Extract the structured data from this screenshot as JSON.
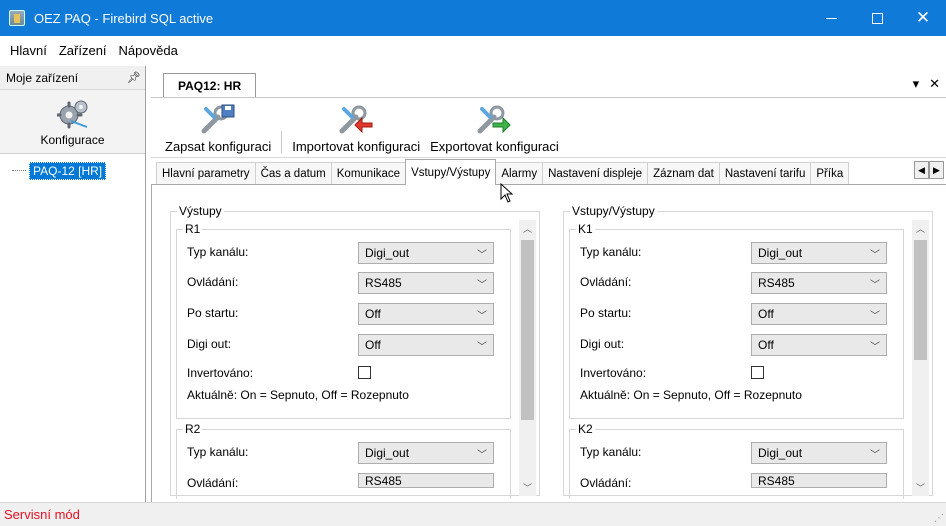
{
  "window": {
    "title": "OEZ PAQ - Firebird SQL active"
  },
  "menu": {
    "items": [
      "Hlavní",
      "Zařízení",
      "Nápověda"
    ]
  },
  "left_panel": {
    "title": "Moje zařízení",
    "tool_label": "Konfigurace",
    "tree_item": "PAQ-12 [HR]"
  },
  "document": {
    "tab_label": "PAQ12: HR",
    "toolbar": {
      "save": "Zapsat konfiguraci",
      "import": "Importovat konfiguraci",
      "export": "Exportovat konfiguraci"
    },
    "subtabs": [
      "Hlavní parametry",
      "Čas a datum",
      "Komunikace",
      "Vstupy/Výstupy",
      "Alarmy",
      "Nastavení displeje",
      "Záznam dat",
      "Nastavení tarifu",
      "Příka"
    ],
    "active_subtab": "Vstupy/Výstupy"
  },
  "labels": {
    "typ_kanalu": "Typ kanálu:",
    "ovladani": "Ovládání:",
    "po_startu": "Po startu:",
    "digi_out": "Digi out:",
    "invertovano": "Invertováno:",
    "aktualne": "Aktuálně: On = Sepnuto, Off = Rozepnuto"
  },
  "left_group": {
    "title": "Výstupy",
    "first": {
      "title": "R1",
      "typ": "Digi_out",
      "ovladani": "RS485",
      "po_startu": "Off",
      "digi_out": "Off",
      "invertovano": false
    },
    "second": {
      "title": "R2",
      "typ": "Digi_out",
      "ovladani": "RS485"
    }
  },
  "right_group": {
    "title": "Vstupy/Výstupy",
    "first": {
      "title": "K1",
      "typ": "Digi_out",
      "ovladani": "RS485",
      "po_startu": "Off",
      "digi_out": "Off",
      "invertovano": false
    },
    "second": {
      "title": "K2",
      "typ": "Digi_out",
      "ovladani": "RS485"
    }
  },
  "status": {
    "text": "Servisní mód"
  }
}
